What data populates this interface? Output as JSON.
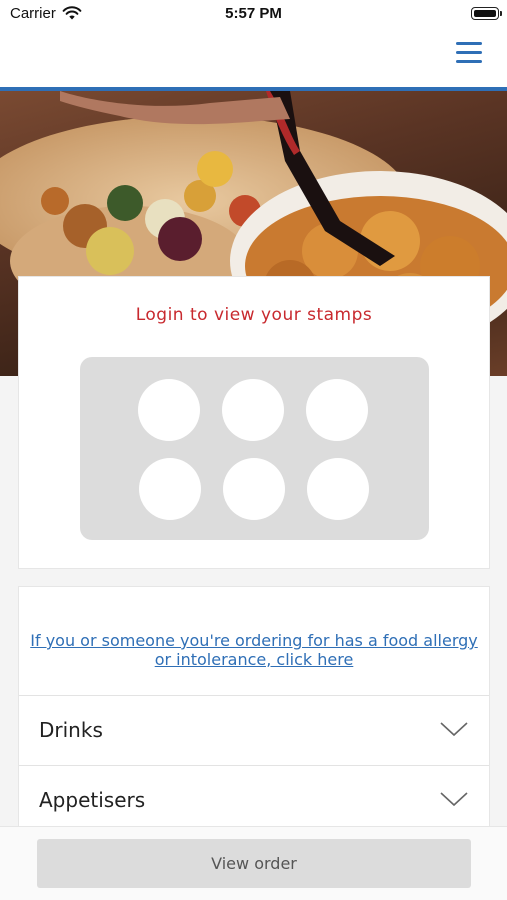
{
  "status_bar": {
    "carrier": "Carrier",
    "time": "5:57 PM"
  },
  "nav": {
    "menu_icon": "hamburger-menu-icon",
    "accent_color": "#2f6fb6"
  },
  "hero": {
    "image": "food-platter-photo"
  },
  "stamps": {
    "title": "Login to view your stamps",
    "title_color": "#c8292e",
    "count": 6
  },
  "allergy_notice": {
    "text": "If you or someone you're ordering for has a food allergy or intolerance, click here"
  },
  "menu_categories": [
    {
      "label": "Drinks",
      "icon": "chevron-down-icon"
    },
    {
      "label": "Appetisers",
      "icon": "chevron-down-icon"
    }
  ],
  "bottom_bar": {
    "view_order_label": "View order"
  }
}
